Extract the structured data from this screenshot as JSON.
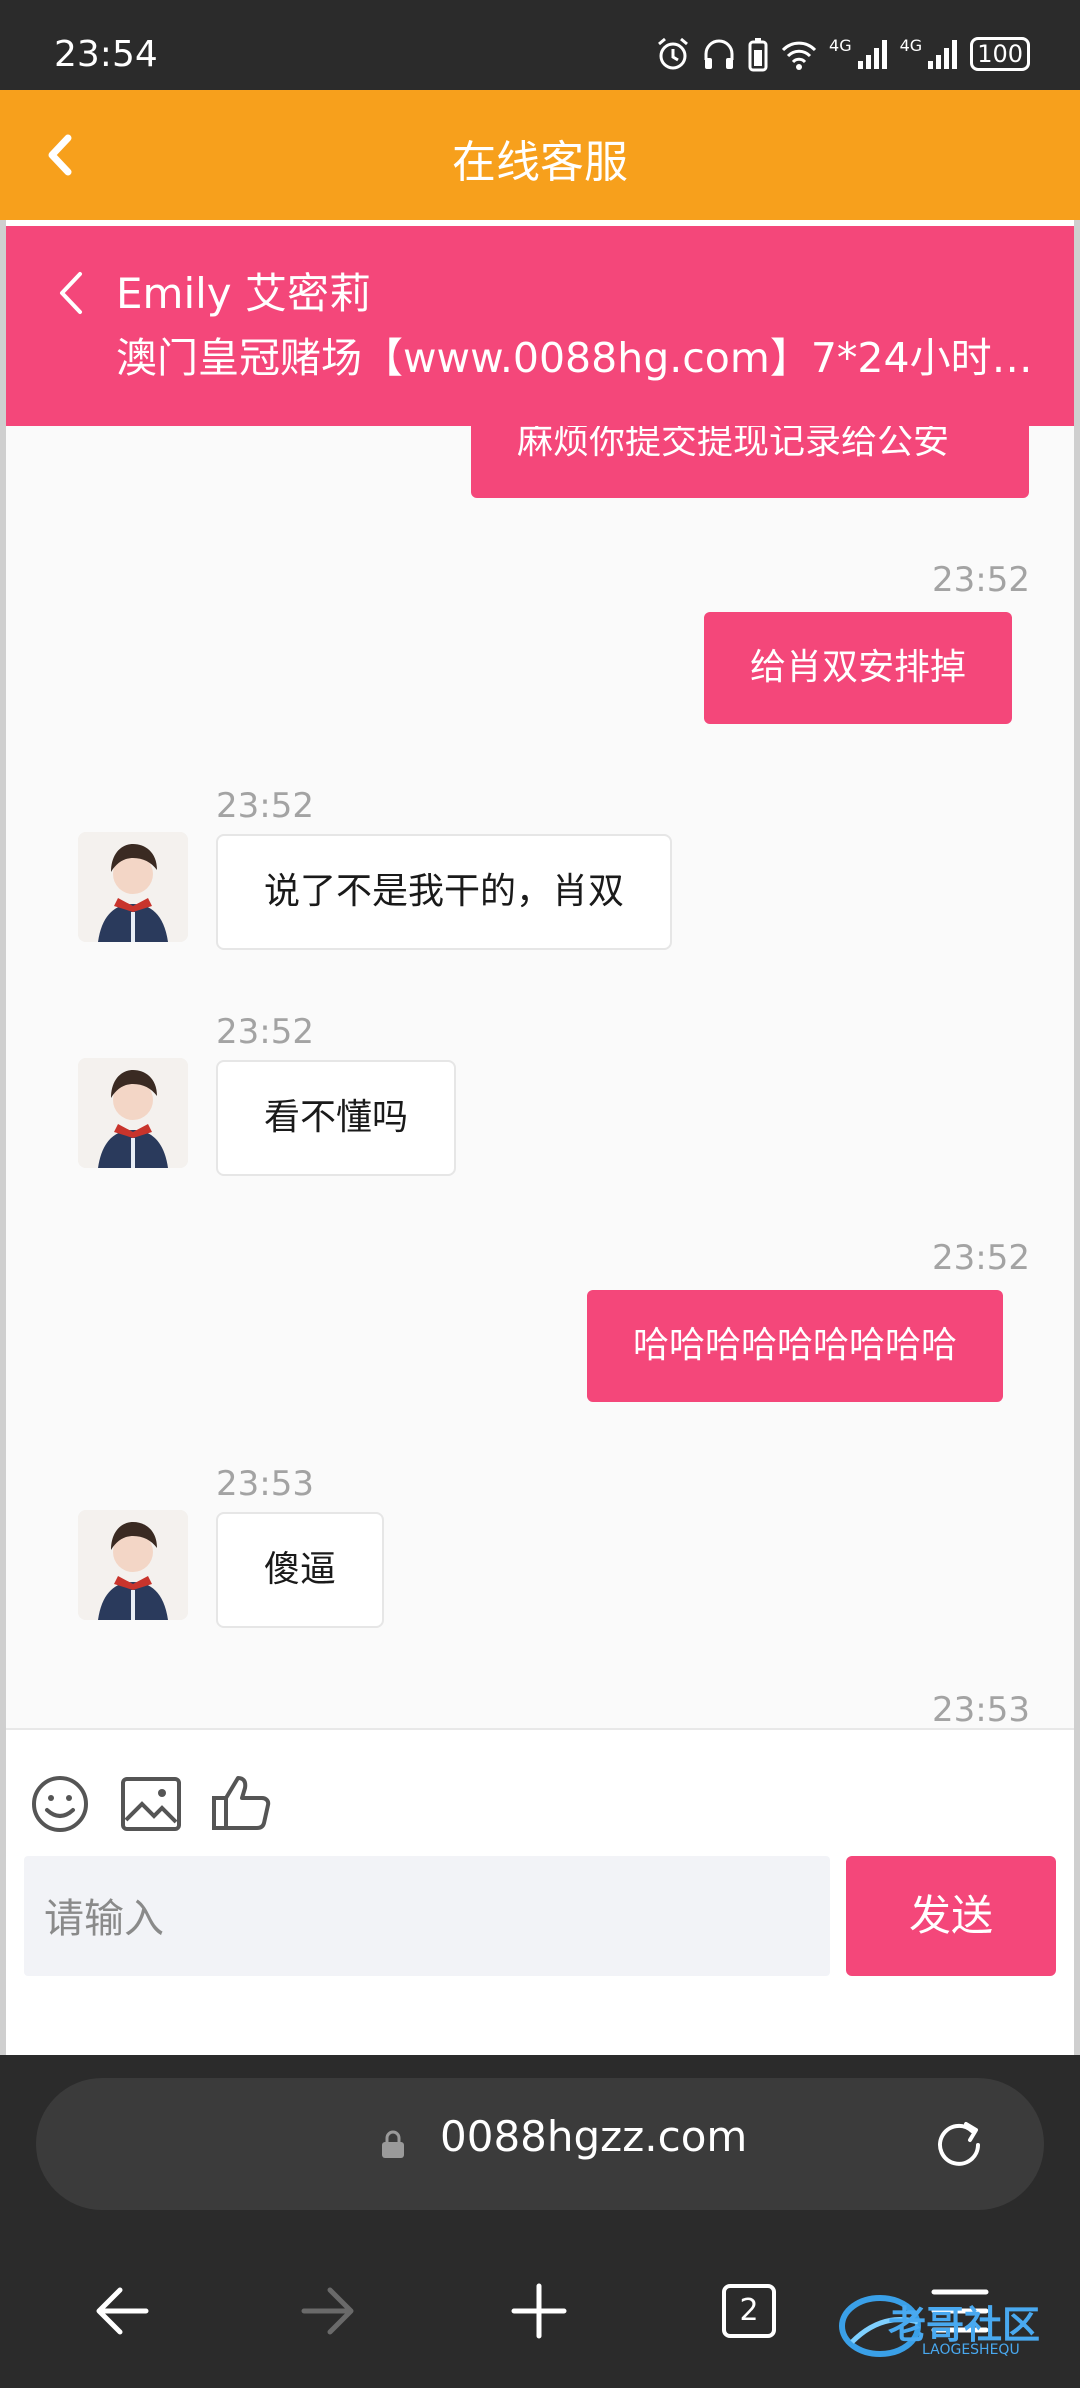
{
  "status_bar": {
    "time": "23:54",
    "signal_1": "4G",
    "signal_2": "4G",
    "battery": "100"
  },
  "app_header": {
    "title": "在线客服",
    "back_icon": "chevron-left-icon"
  },
  "contact": {
    "name": "Emily 艾密莉",
    "subtitle": "澳门皇冠赌场【www.0088hg.com】7*24小时…"
  },
  "messages": [
    {
      "dir": "out",
      "time": "",
      "text": "麻烦你提交提现记录给公安"
    },
    {
      "dir": "out",
      "time": "23:52",
      "text": "给肖双安排掉"
    },
    {
      "dir": "in",
      "time": "23:52",
      "text": "说了不是我干的，肖双"
    },
    {
      "dir": "in",
      "time": "23:52",
      "text": "看不懂吗"
    },
    {
      "dir": "out",
      "time": "23:52",
      "text": "哈哈哈哈哈哈哈哈哈"
    },
    {
      "dir": "in",
      "time": "23:53",
      "text": "傻逼"
    },
    {
      "dir": "out",
      "time": "23:53",
      "text": ""
    }
  ],
  "composer": {
    "placeholder": "请输入",
    "send_label": "发送"
  },
  "browser": {
    "url": "0088hgzz.com",
    "tab_count": "2"
  },
  "watermark": {
    "text": "老哥社区",
    "subtext": "LAOGESHEQU"
  }
}
